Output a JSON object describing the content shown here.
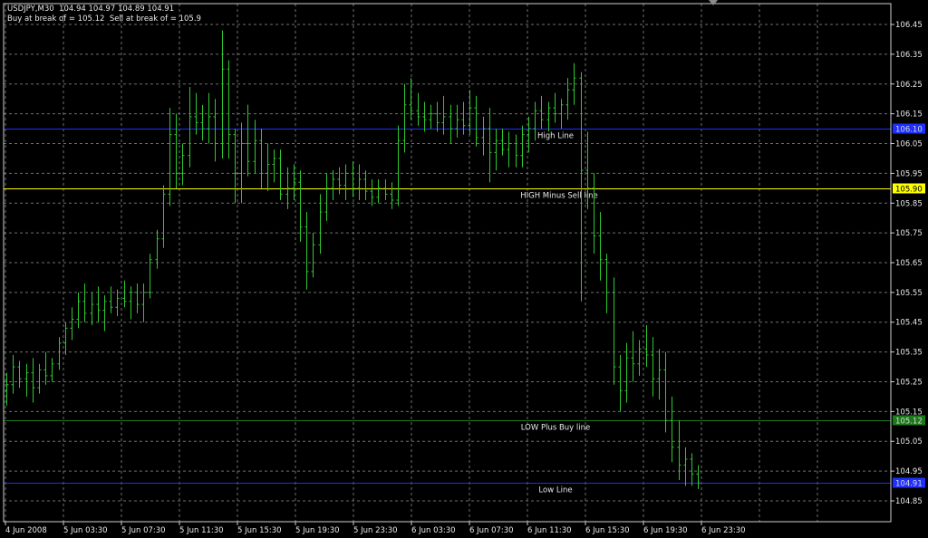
{
  "header": {
    "symbol_line": "USDJPY,M30  104.94 104.97 104.89 104.91",
    "info_line": "Buy at break of = 105.12  Sell at break of = 105.9"
  },
  "colors": {
    "background": "#000000",
    "grid": "#6f6f6f",
    "frame": "#cfcfcf",
    "bars": "#2ec82e",
    "high_line": "#1e2fff",
    "sell_line": "#ffff00",
    "buy_line": "#1a7a1a",
    "low_line": "#1e2fff",
    "text": "#e8e8e8"
  },
  "chart_data": {
    "type": "ohlc",
    "symbol": "USDJPY",
    "timeframe": "M30",
    "ylim": [
      104.78,
      106.52
    ],
    "y_ticks": [
      "106.45",
      "106.35",
      "106.25",
      "106.15",
      "106.05",
      "105.95",
      "105.85",
      "105.75",
      "105.65",
      "105.55",
      "105.45",
      "105.35",
      "105.25",
      "105.15",
      "105.05",
      "104.95",
      "104.85"
    ],
    "x_ticks": [
      "4 Jun 2008",
      "5 Jun 03:30",
      "5 Jun 07:30",
      "5 Jun 11:30",
      "5 Jun 15:30",
      "5 Jun 19:30",
      "5 Jun 23:30",
      "6 Jun 03:30",
      "6 Jun 07:30",
      "6 Jun 11:30",
      "6 Jun 15:30",
      "6 Jun 19:30",
      "6 Jun 23:30"
    ],
    "levels": [
      {
        "name": "High Line",
        "value": 106.1,
        "price_tag": "106.10",
        "color_key": "high_line"
      },
      {
        "name": "HIGH Minus Sell line",
        "value": 105.9,
        "price_tag": "105.90",
        "color_key": "sell_line"
      },
      {
        "name": "LOW Plus Buy line",
        "value": 105.12,
        "price_tag": "105.12",
        "color_key": "buy_line"
      },
      {
        "name": "Low Line",
        "value": 104.91,
        "price_tag": "104.91",
        "color_key": "low_line"
      }
    ],
    "bars": [
      [
        105.22,
        105.28,
        105.17,
        105.24
      ],
      [
        105.24,
        105.34,
        105.21,
        105.3
      ],
      [
        105.3,
        105.32,
        105.23,
        105.26
      ],
      [
        105.26,
        105.31,
        105.2,
        105.28
      ],
      [
        105.28,
        105.33,
        105.18,
        105.23
      ],
      [
        105.23,
        105.31,
        105.21,
        105.29
      ],
      [
        105.29,
        105.35,
        105.24,
        105.27
      ],
      [
        105.27,
        105.33,
        105.25,
        105.31
      ],
      [
        105.31,
        105.4,
        105.29,
        105.38
      ],
      [
        105.38,
        105.45,
        105.34,
        105.43
      ],
      [
        105.43,
        105.5,
        105.39,
        105.46
      ],
      [
        105.46,
        105.55,
        105.43,
        105.52
      ],
      [
        105.52,
        105.58,
        105.45,
        105.48
      ],
      [
        105.48,
        105.55,
        105.44,
        105.51
      ],
      [
        105.51,
        105.57,
        105.45,
        105.49
      ],
      [
        105.49,
        105.54,
        105.42,
        105.52
      ],
      [
        105.52,
        105.57,
        105.48,
        105.5
      ],
      [
        105.5,
        105.56,
        105.47,
        105.53
      ],
      [
        105.53,
        105.59,
        105.5,
        105.52
      ],
      [
        105.52,
        105.57,
        105.46,
        105.55
      ],
      [
        105.55,
        105.58,
        105.48,
        105.51
      ],
      [
        105.51,
        105.58,
        105.45,
        105.55
      ],
      [
        105.55,
        105.68,
        105.53,
        105.66
      ],
      [
        105.66,
        105.76,
        105.63,
        105.73
      ],
      [
        105.73,
        105.91,
        105.7,
        105.88
      ],
      [
        105.88,
        106.17,
        105.84,
        106.08
      ],
      [
        106.08,
        106.15,
        105.9,
        105.95
      ],
      [
        105.95,
        106.05,
        105.91,
        106.01
      ],
      [
        106.01,
        106.24,
        105.97,
        106.14
      ],
      [
        106.14,
        106.22,
        106.08,
        106.12
      ],
      [
        106.12,
        106.18,
        106.06,
        106.1
      ],
      [
        106.1,
        106.22,
        106.05,
        106.14
      ],
      [
        106.14,
        106.2,
        105.99,
        106.05
      ],
      [
        106.05,
        106.43,
        106.0,
        106.3
      ],
      [
        106.3,
        106.33,
        106.0,
        106.08
      ],
      [
        106.08,
        106.1,
        105.85,
        105.95
      ],
      [
        105.95,
        106.12,
        105.85,
        106.05
      ],
      [
        106.05,
        106.18,
        105.94,
        105.99
      ],
      [
        105.99,
        106.13,
        105.95,
        106.06
      ],
      [
        106.06,
        106.1,
        105.9,
        105.95
      ],
      [
        105.95,
        106.05,
        105.89,
        105.98
      ],
      [
        105.98,
        106.03,
        105.92,
        106.0
      ],
      [
        106.0,
        106.03,
        105.86,
        105.88
      ],
      [
        105.88,
        105.97,
        105.83,
        105.9
      ],
      [
        105.9,
        105.98,
        105.86,
        105.92
      ],
      [
        105.92,
        105.96,
        105.72,
        105.77
      ],
      [
        105.77,
        105.82,
        105.56,
        105.62
      ],
      [
        105.62,
        105.75,
        105.6,
        105.71
      ],
      [
        105.71,
        105.88,
        105.68,
        105.82
      ],
      [
        105.82,
        105.95,
        105.79,
        105.9
      ],
      [
        105.9,
        105.96,
        105.86,
        105.93
      ],
      [
        105.93,
        105.97,
        105.88,
        105.91
      ],
      [
        105.91,
        105.98,
        105.86,
        105.95
      ],
      [
        105.95,
        105.99,
        105.87,
        105.9
      ],
      [
        105.9,
        105.98,
        105.86,
        105.93
      ],
      [
        105.93,
        105.96,
        105.86,
        105.89
      ],
      [
        105.89,
        105.93,
        105.84,
        105.87
      ],
      [
        105.87,
        105.93,
        105.85,
        105.9
      ],
      [
        105.9,
        105.93,
        105.86,
        105.88
      ],
      [
        105.88,
        105.92,
        105.83,
        105.86
      ],
      [
        105.86,
        106.11,
        105.84,
        106.06
      ],
      [
        106.06,
        106.25,
        106.02,
        106.18
      ],
      [
        106.18,
        106.27,
        106.13,
        106.16
      ],
      [
        106.16,
        106.22,
        106.11,
        106.14
      ],
      [
        106.14,
        106.19,
        106.09,
        106.13
      ],
      [
        106.13,
        106.18,
        106.1,
        106.15
      ],
      [
        106.15,
        106.19,
        106.09,
        106.12
      ],
      [
        106.12,
        106.21,
        106.08,
        106.14
      ],
      [
        106.14,
        106.18,
        106.05,
        106.1
      ],
      [
        106.1,
        106.18,
        106.07,
        106.13
      ],
      [
        106.13,
        106.19,
        106.08,
        106.11
      ],
      [
        106.11,
        106.23,
        106.08,
        106.17
      ],
      [
        106.17,
        106.21,
        106.04,
        106.07
      ],
      [
        106.07,
        106.14,
        106.01,
        106.1
      ],
      [
        106.1,
        106.17,
        105.92,
        106.02
      ],
      [
        106.02,
        106.1,
        105.96,
        106.06
      ],
      [
        106.06,
        106.1,
        106.01,
        106.03
      ],
      [
        106.03,
        106.09,
        105.97,
        106.05
      ],
      [
        106.05,
        106.08,
        105.97,
        106.01
      ],
      [
        106.01,
        106.11,
        105.97,
        106.08
      ],
      [
        106.08,
        106.14,
        106.02,
        106.1
      ],
      [
        106.1,
        106.19,
        106.06,
        106.16
      ],
      [
        106.16,
        106.21,
        106.1,
        106.13
      ],
      [
        106.13,
        106.19,
        106.09,
        106.17
      ],
      [
        106.17,
        106.22,
        106.12,
        106.15
      ],
      [
        106.15,
        106.2,
        106.1,
        106.18
      ],
      [
        106.18,
        106.27,
        106.13,
        106.23
      ],
      [
        106.23,
        106.32,
        106.18,
        106.27
      ],
      [
        106.27,
        106.29,
        105.52,
        105.96
      ],
      [
        105.96,
        106.09,
        105.83,
        105.9
      ],
      [
        105.9,
        105.95,
        105.68,
        105.74
      ],
      [
        105.74,
        105.82,
        105.59,
        105.66
      ],
      [
        105.66,
        105.68,
        105.48,
        105.55
      ],
      [
        105.55,
        105.6,
        105.24,
        105.3
      ],
      [
        105.3,
        105.34,
        105.15,
        105.22
      ],
      [
        105.22,
        105.38,
        105.18,
        105.33
      ],
      [
        105.33,
        105.42,
        105.25,
        105.31
      ],
      [
        105.31,
        105.39,
        105.27,
        105.36
      ],
      [
        105.36,
        105.44,
        105.3,
        105.34
      ],
      [
        105.34,
        105.4,
        105.2,
        105.26
      ],
      [
        105.26,
        105.36,
        105.19,
        105.29
      ],
      [
        105.29,
        105.35,
        105.08,
        105.12
      ],
      [
        105.12,
        105.2,
        104.98,
        105.03
      ],
      [
        105.03,
        105.12,
        104.92,
        104.97
      ],
      [
        104.97,
        105.03,
        104.9,
        104.99
      ],
      [
        104.99,
        105.01,
        104.9,
        104.94
      ],
      [
        104.94,
        104.97,
        104.89,
        104.91
      ]
    ]
  }
}
